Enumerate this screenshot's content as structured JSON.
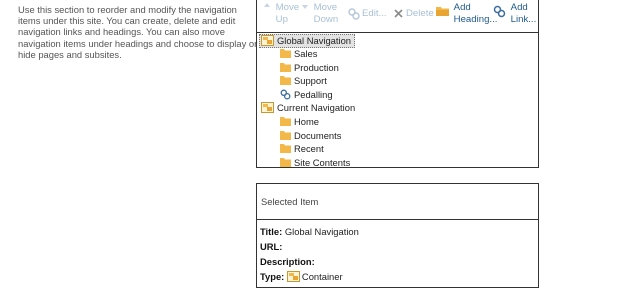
{
  "description": {
    "lines": [
      "Use this section to reorder and modify the navigation",
      "items under this site. You can create, delete and edit",
      "navigation links and headings. You can also move",
      "navigation items under headings and choose to display or",
      "hide pages and subsites."
    ]
  },
  "toolbar": {
    "move_up": [
      "Move",
      "Up"
    ],
    "move_down": [
      "Move",
      "Down"
    ],
    "edit": "Edit...",
    "delete": "Delete",
    "add_heading": [
      "Add",
      "Heading..."
    ],
    "add_link": [
      "Add",
      "Link..."
    ]
  },
  "tree": {
    "global": {
      "label": "Global Navigation",
      "children": [
        "Sales",
        "Production",
        "Support",
        "Pedalling"
      ]
    },
    "current": {
      "label": "Current Navigation",
      "children": [
        "Home",
        "Documents",
        "Recent",
        "Site Contents"
      ]
    }
  },
  "selected_item": {
    "heading": "Selected Item",
    "title_label": "Title:",
    "title_value": "Global Navigation",
    "url_label": "URL:",
    "description_label": "Description:",
    "type_label": "Type:",
    "type_value": "Container"
  },
  "colors": {
    "link": "#1f5a8c",
    "disabled": "#a9c1d6",
    "folder": "#f2b94a",
    "selection": "#e3e3e3"
  }
}
